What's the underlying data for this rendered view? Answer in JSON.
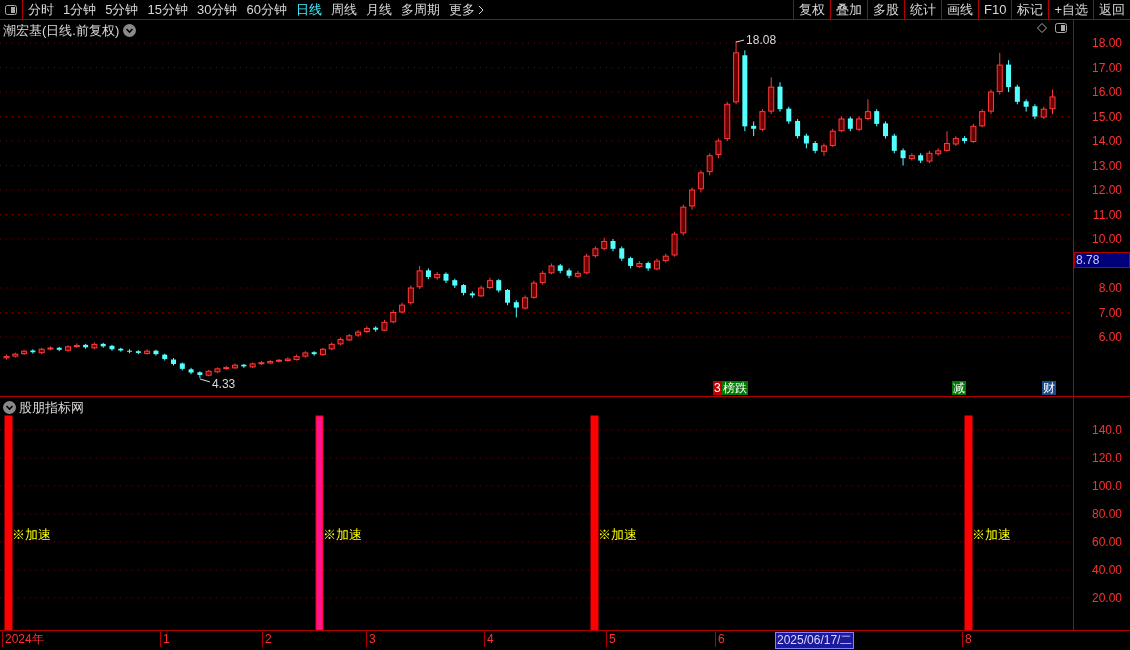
{
  "toolbar": {
    "periods": [
      {
        "label": "分时",
        "selected": false
      },
      {
        "label": "1分钟",
        "selected": false
      },
      {
        "label": "5分钟",
        "selected": false
      },
      {
        "label": "15分钟",
        "selected": false
      },
      {
        "label": "30分钟",
        "selected": false
      },
      {
        "label": "60分钟",
        "selected": false
      },
      {
        "label": "日线",
        "selected": true
      },
      {
        "label": "周线",
        "selected": false
      },
      {
        "label": "月线",
        "selected": false
      },
      {
        "label": "多周期",
        "selected": false
      }
    ],
    "more": "更多",
    "actions": [
      "复权",
      "叠加",
      "多股",
      "统计",
      "画线",
      "F10",
      "标记",
      "+自选",
      "返回"
    ]
  },
  "price_panel": {
    "title": "潮宏基(日线.前复权)",
    "high_label": "18.08",
    "low_label": "4.33",
    "chart_data": {
      "type": "candlestick",
      "grid": true,
      "ylim": [
        -5.96,
        18.94
      ],
      "yticks": [
        {
          "value": 18,
          "label": "18.00"
        },
        {
          "value": 17,
          "label": "17.00"
        },
        {
          "value": 16,
          "label": "16.00"
        },
        {
          "value": 15,
          "label": "15.00"
        },
        {
          "value": 14,
          "label": "14.00"
        },
        {
          "value": 13,
          "label": "13.00"
        },
        {
          "value": 12,
          "label": "12.00"
        },
        {
          "value": 11,
          "label": "11.00"
        },
        {
          "value": 10,
          "label": "10.00"
        },
        {
          "value": 8,
          "label": "8.00"
        },
        {
          "value": 7,
          "label": "7.00"
        },
        {
          "value": 6,
          "label": "6.00"
        }
      ],
      "categories": [
        null,
        null,
        null,
        null,
        null,
        null,
        null,
        null,
        null,
        null,
        null,
        null,
        null,
        null,
        null,
        null,
        null,
        null,
        null,
        null,
        null,
        null,
        null,
        null,
        null,
        null,
        null,
        null,
        null,
        null,
        null,
        null,
        null,
        null,
        null,
        null,
        null,
        null,
        null,
        null,
        null,
        null,
        null,
        null,
        null,
        null,
        null,
        null,
        null,
        null,
        null,
        null,
        null,
        null,
        null,
        null,
        null,
        null,
        null,
        null,
        null,
        null,
        null,
        null,
        null,
        null,
        null,
        null,
        null,
        null,
        null,
        null,
        null,
        null,
        null,
        null,
        null,
        null,
        null,
        null,
        null,
        null,
        null,
        null,
        null,
        null,
        null,
        null,
        null,
        null,
        null,
        null,
        null,
        null,
        null,
        null,
        null,
        null,
        null,
        null,
        null,
        null,
        null,
        null,
        null,
        null,
        null,
        null,
        null,
        null,
        null,
        null,
        null,
        null,
        null,
        null,
        null,
        null,
        null,
        null
      ],
      "ohlc": [
        [
          5.15,
          5.28,
          5.08,
          5.2
        ],
        [
          5.22,
          5.36,
          5.16,
          5.3
        ],
        [
          5.32,
          5.48,
          5.26,
          5.42
        ],
        [
          5.45,
          5.5,
          5.32,
          5.38
        ],
        [
          5.36,
          5.56,
          5.3,
          5.5
        ],
        [
          5.52,
          5.62,
          5.46,
          5.55
        ],
        [
          5.56,
          5.6,
          5.42,
          5.48
        ],
        [
          5.46,
          5.66,
          5.4,
          5.6
        ],
        [
          5.62,
          5.74,
          5.56,
          5.65
        ],
        [
          5.68,
          5.72,
          5.52,
          5.58
        ],
        [
          5.56,
          5.78,
          5.5,
          5.7
        ],
        [
          5.72,
          5.76,
          5.56,
          5.62
        ],
        [
          5.64,
          5.68,
          5.44,
          5.5
        ],
        [
          5.52,
          5.56,
          5.4,
          5.45
        ],
        [
          5.44,
          5.5,
          5.34,
          5.4
        ],
        [
          5.42,
          5.46,
          5.3,
          5.35
        ],
        [
          5.33,
          5.5,
          5.28,
          5.42
        ],
        [
          5.44,
          5.48,
          5.24,
          5.3
        ],
        [
          5.28,
          5.32,
          5.04,
          5.1
        ],
        [
          5.08,
          5.14,
          4.84,
          4.9
        ],
        [
          4.92,
          4.96,
          4.64,
          4.7
        ],
        [
          4.68,
          4.74,
          4.48,
          4.55
        ],
        [
          4.56,
          4.6,
          4.33,
          4.45
        ],
        [
          4.44,
          4.66,
          4.4,
          4.6
        ],
        [
          4.58,
          4.76,
          4.54,
          4.7
        ],
        [
          4.72,
          4.82,
          4.66,
          4.75
        ],
        [
          4.74,
          4.92,
          4.7,
          4.85
        ],
        [
          4.87,
          4.9,
          4.74,
          4.8
        ],
        [
          4.78,
          4.96,
          4.74,
          4.9
        ],
        [
          4.92,
          5.02,
          4.86,
          4.95
        ],
        [
          4.94,
          5.06,
          4.9,
          5.0
        ],
        [
          5.02,
          5.1,
          4.96,
          5.05
        ],
        [
          5.04,
          5.16,
          5.0,
          5.1
        ],
        [
          5.08,
          5.28,
          5.04,
          5.2
        ],
        [
          5.22,
          5.42,
          5.16,
          5.35
        ],
        [
          5.38,
          5.42,
          5.24,
          5.3
        ],
        [
          5.28,
          5.56,
          5.24,
          5.5
        ],
        [
          5.52,
          5.78,
          5.46,
          5.7
        ],
        [
          5.72,
          5.98,
          5.66,
          5.9
        ],
        [
          5.88,
          6.12,
          5.84,
          6.05
        ],
        [
          6.08,
          6.28,
          6.0,
          6.2
        ],
        [
          6.22,
          6.44,
          6.16,
          6.35
        ],
        [
          6.38,
          6.44,
          6.22,
          6.3
        ],
        [
          6.28,
          6.7,
          6.24,
          6.6
        ],
        [
          6.62,
          7.1,
          6.56,
          7.0
        ],
        [
          7.02,
          7.4,
          6.96,
          7.3
        ],
        [
          7.4,
          8.1,
          7.32,
          8.0
        ],
        [
          8.05,
          8.9,
          7.96,
          8.7
        ],
        [
          8.72,
          8.8,
          8.36,
          8.45
        ],
        [
          8.42,
          8.66,
          8.34,
          8.55
        ],
        [
          8.58,
          8.64,
          8.2,
          8.3
        ],
        [
          8.32,
          8.38,
          8.0,
          8.1
        ],
        [
          8.12,
          8.16,
          7.7,
          7.8
        ],
        [
          7.78,
          7.86,
          7.6,
          7.7
        ],
        [
          7.68,
          8.1,
          7.64,
          8.0
        ],
        [
          8.02,
          8.42,
          7.96,
          8.3
        ],
        [
          8.32,
          8.36,
          7.82,
          7.9
        ],
        [
          7.92,
          7.96,
          7.3,
          7.4
        ],
        [
          7.42,
          7.5,
          6.8,
          7.2
        ],
        [
          7.18,
          7.7,
          7.12,
          7.6
        ],
        [
          7.62,
          8.3,
          7.56,
          8.2
        ],
        [
          8.22,
          8.7,
          8.14,
          8.6
        ],
        [
          8.62,
          9.0,
          8.56,
          8.9
        ],
        [
          8.92,
          8.98,
          8.6,
          8.7
        ],
        [
          8.72,
          8.8,
          8.4,
          8.5
        ],
        [
          8.48,
          8.7,
          8.42,
          8.6
        ],
        [
          8.62,
          9.4,
          8.56,
          9.3
        ],
        [
          9.32,
          9.7,
          9.24,
          9.6
        ],
        [
          9.62,
          10.05,
          9.54,
          9.9
        ],
        [
          9.92,
          10.0,
          9.5,
          9.6
        ],
        [
          9.62,
          9.7,
          9.1,
          9.2
        ],
        [
          9.22,
          9.28,
          8.8,
          8.9
        ],
        [
          8.88,
          9.1,
          8.82,
          9.0
        ],
        [
          9.02,
          9.08,
          8.7,
          8.8
        ],
        [
          8.78,
          9.2,
          8.72,
          9.1
        ],
        [
          9.12,
          9.4,
          9.04,
          9.3
        ],
        [
          9.35,
          10.3,
          9.28,
          10.2
        ],
        [
          10.25,
          11.4,
          10.15,
          11.3
        ],
        [
          11.35,
          12.1,
          11.2,
          12.0
        ],
        [
          12.05,
          12.8,
          11.9,
          12.7
        ],
        [
          12.75,
          13.5,
          12.6,
          13.4
        ],
        [
          13.45,
          14.1,
          13.3,
          14.0
        ],
        [
          14.1,
          15.6,
          14.0,
          15.5
        ],
        [
          15.6,
          18.08,
          15.5,
          17.6
        ],
        [
          17.5,
          17.7,
          14.4,
          14.6
        ],
        [
          14.62,
          14.8,
          14.2,
          14.5
        ],
        [
          14.48,
          15.3,
          14.4,
          15.2
        ],
        [
          15.22,
          16.6,
          15.1,
          16.2
        ],
        [
          16.22,
          16.4,
          15.2,
          15.3
        ],
        [
          15.32,
          15.4,
          14.7,
          14.8
        ],
        [
          14.82,
          14.9,
          14.1,
          14.2
        ],
        [
          14.22,
          14.3,
          13.7,
          13.9
        ],
        [
          13.92,
          14.0,
          13.5,
          13.6
        ],
        [
          13.58,
          13.9,
          13.4,
          13.8
        ],
        [
          13.82,
          14.5,
          13.76,
          14.4
        ],
        [
          14.42,
          15.0,
          14.36,
          14.9
        ],
        [
          14.92,
          15.0,
          14.4,
          14.5
        ],
        [
          14.48,
          15.0,
          14.4,
          14.9
        ],
        [
          14.92,
          15.7,
          14.84,
          15.2
        ],
        [
          15.22,
          15.3,
          14.6,
          14.7
        ],
        [
          14.72,
          14.8,
          14.1,
          14.2
        ],
        [
          14.22,
          14.3,
          13.5,
          13.6
        ],
        [
          13.62,
          13.7,
          13.0,
          13.3
        ],
        [
          13.28,
          13.5,
          13.2,
          13.4
        ],
        [
          13.42,
          13.5,
          13.1,
          13.2
        ],
        [
          13.18,
          13.6,
          13.1,
          13.5
        ],
        [
          13.48,
          13.7,
          13.4,
          13.6
        ],
        [
          13.62,
          14.4,
          13.56,
          13.9
        ],
        [
          13.88,
          14.2,
          13.8,
          14.1
        ],
        [
          14.12,
          14.2,
          13.9,
          14.0
        ],
        [
          13.98,
          14.7,
          13.92,
          14.6
        ],
        [
          14.62,
          15.3,
          14.56,
          15.2
        ],
        [
          15.22,
          16.1,
          15.1,
          16.0
        ],
        [
          16.02,
          17.6,
          15.9,
          17.1
        ],
        [
          17.12,
          17.3,
          16.0,
          16.2
        ],
        [
          16.22,
          16.3,
          15.5,
          15.6
        ],
        [
          15.62,
          15.7,
          15.2,
          15.4
        ],
        [
          15.42,
          15.5,
          14.9,
          15.0
        ],
        [
          14.98,
          15.4,
          14.9,
          15.3
        ],
        [
          15.32,
          16.1,
          15.1,
          15.8
        ]
      ]
    },
    "current_price": "8.78",
    "events": [
      {
        "label": "3",
        "color": "#c00000"
      },
      {
        "label": "榜跌",
        "color": "#007a00"
      },
      {
        "label": "减",
        "color": "#007a00"
      },
      {
        "label": "财",
        "color": "#1a4a8a"
      }
    ]
  },
  "indicator_panel": {
    "title": "股朋指标网",
    "signals": [
      {
        "label": "※加速",
        "color": "#ff0000"
      },
      {
        "label": "※加速",
        "color": "#ff1493"
      },
      {
        "label": "※加速",
        "color": "#ff0000"
      },
      {
        "label": "※加速",
        "color": "#ff0000"
      }
    ],
    "axis_labels": [
      "140.0",
      "120.0",
      "100.0",
      "80.00",
      "60.00",
      "40.00",
      "20.00"
    ]
  },
  "date_axis": [
    {
      "label": "2024年",
      "selected": false
    },
    {
      "label": "1",
      "selected": false
    },
    {
      "label": "2",
      "selected": false
    },
    {
      "label": "3",
      "selected": false
    },
    {
      "label": "4",
      "selected": false
    },
    {
      "label": "5",
      "selected": false
    },
    {
      "label": "6",
      "selected": false
    },
    {
      "label": "2025/06/17/二",
      "selected": true
    },
    {
      "label": "8",
      "selected": false
    }
  ]
}
